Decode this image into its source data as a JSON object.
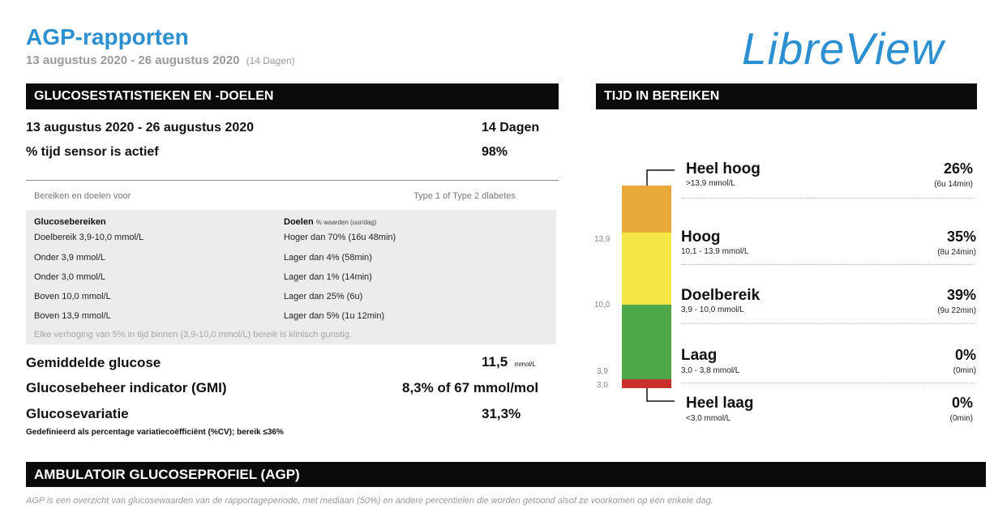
{
  "header": {
    "title": "AGP-rapporten",
    "date_range": "13 augustus 2020 - 26 augustus 2020",
    "days": "(14 Dagen)",
    "logo": "LibreView"
  },
  "stats": {
    "section_title": "GLUCOSESTATISTIEKEN EN -DOELEN",
    "period_label": "13 augustus 2020 - 26 augustus 2020",
    "period_value": "14 Dagen",
    "sensor_label": "% tijd sensor is actief",
    "sensor_value": "98%",
    "ranges_label": "Bereiken en doelen voor",
    "ranges_type": "Type 1 of Type 2 diabetes",
    "goals_header_left": "Glucosebereiken",
    "goals_header_right": "Doelen",
    "goals_header_right_small": "% waarden (uur/dag)",
    "goals": [
      {
        "range": "Doelbereik 3,9-10,0 mmol/L",
        "goal": "Hoger dan 70% (16u 48min)"
      },
      {
        "range": "Onder 3,9 mmol/L",
        "goal": "Lager dan 4% (58min)"
      },
      {
        "range": "Onder 3,0 mmol/L",
        "goal": "Lager dan 1% (14min)"
      },
      {
        "range": "Boven 10,0 mmol/L",
        "goal": "Lager dan 25% (6u)"
      },
      {
        "range": "Boven 13,9 mmol/L",
        "goal": "Lager dan 5% (1u 12min)"
      }
    ],
    "goals_note": "Elke verhoging van 5% in tijd binnen (3,9-10,0 mmol/L) bereik is klinisch gunstig.",
    "mean_label": "Gemiddelde glucose",
    "mean_value": "11,5",
    "mean_unit": "mmol/L",
    "gmi_label": "Glucosebeheer indicator (GMI)",
    "gmi_value": "8,3% of 67 mmol/mol",
    "cv_label": "Glucosevariatie",
    "cv_value": "31,3%",
    "cv_note": "Gedefinieerd als percentage variatiecoëfficiënt (%CV); bereik ≤36%"
  },
  "tir": {
    "section_title": "TIJD IN BEREIKEN",
    "ticks": [
      "13,9",
      "10,0",
      "3,9",
      "3,0"
    ],
    "ranges": [
      {
        "name": "Heel hoog",
        "sub": ">13,9 mmol/L",
        "pct": "26%",
        "dur": "(6u 14min)",
        "color": "#e8a93a"
      },
      {
        "name": "Hoog",
        "sub": "10,1 - 13,9 mmol/L",
        "pct": "35%",
        "dur": "(8u 24min)",
        "color": "#f5e648"
      },
      {
        "name": "Doelbereik",
        "sub": "3,9 - 10,0 mmol/L",
        "pct": "39%",
        "dur": "(9u 22min)",
        "color": "#4ea84a"
      },
      {
        "name": "Laag",
        "sub": "3,0 - 3,8 mmol/L",
        "pct": "0%",
        "dur": "(0min)",
        "color": "#c8312b"
      },
      {
        "name": "Heel laag",
        "sub": "<3,0 mmol/L",
        "pct": "0%",
        "dur": "(0min)",
        "color": "#9c1f1f"
      }
    ]
  },
  "agp": {
    "section_title": "AMBULATOIR GLUCOSEPROFIEL (AGP)",
    "note": "AGP is een overzicht van glucosewaarden van de rapportageperiode, met mediaan (50%) en andere percentielen die worden getoond alsof ze voorkomen op één enkele dag."
  }
}
